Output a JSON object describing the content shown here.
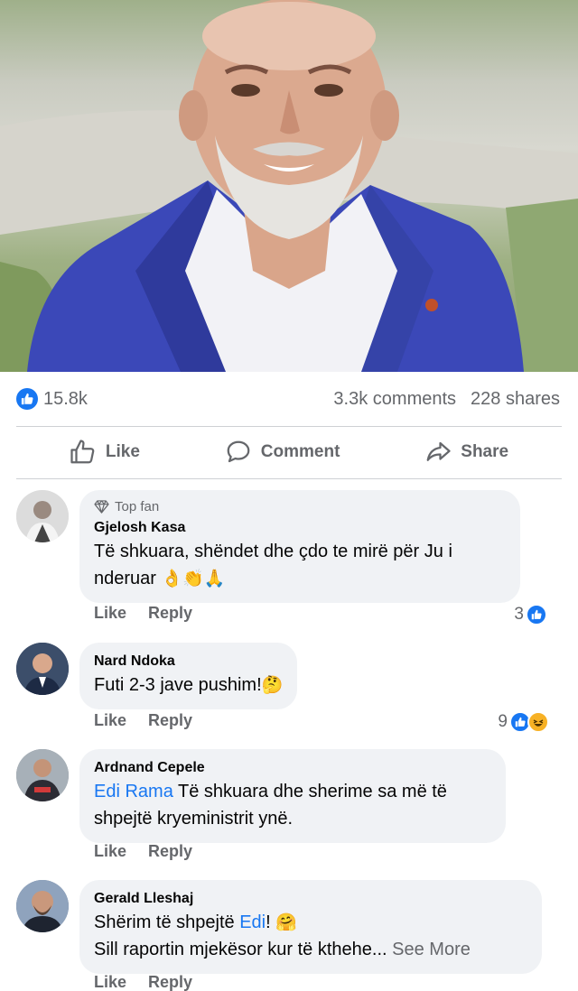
{
  "post": {
    "reactions_count": "15.8k",
    "comments_count": "3.3k comments",
    "shares_count": "228 shares"
  },
  "actions": {
    "like": "Like",
    "comment": "Comment",
    "share": "Share"
  },
  "comments": [
    {
      "badge": "Top fan",
      "author": "Gjelosh Kasa",
      "text": "Të shkuara, shëndet dhe çdo te mirë për Ju i nderuar",
      "emojis": "👌👏🙏",
      "like": "Like",
      "reply": "Reply",
      "reaction_count": "3"
    },
    {
      "author": "Nard Ndoka",
      "text": "Futi 2-3 jave pushim!",
      "emojis": "🤔",
      "like": "Like",
      "reply": "Reply",
      "reaction_count": "9"
    },
    {
      "author": "Ardnand Cepele",
      "mention": "Edi Rama",
      "text": " Të shkuara dhe sherime sa më të shpejtë kryeministrit ynë.",
      "like": "Like",
      "reply": "Reply"
    },
    {
      "author": "Gerald Lleshaj",
      "text_before": "Shërim të shpejtë ",
      "mention": "Edi",
      "text_after": "! ",
      "emojis": "🤗",
      "line2": "Sill raportin mjekësor kur të kthehe...",
      "see_more": " See More",
      "like": "Like",
      "reply": "Reply"
    }
  ],
  "colors": {
    "accent": "#1877f2",
    "secondary_text": "#65676b",
    "bubble": "#f0f2f5",
    "haha": "#f7b125"
  }
}
